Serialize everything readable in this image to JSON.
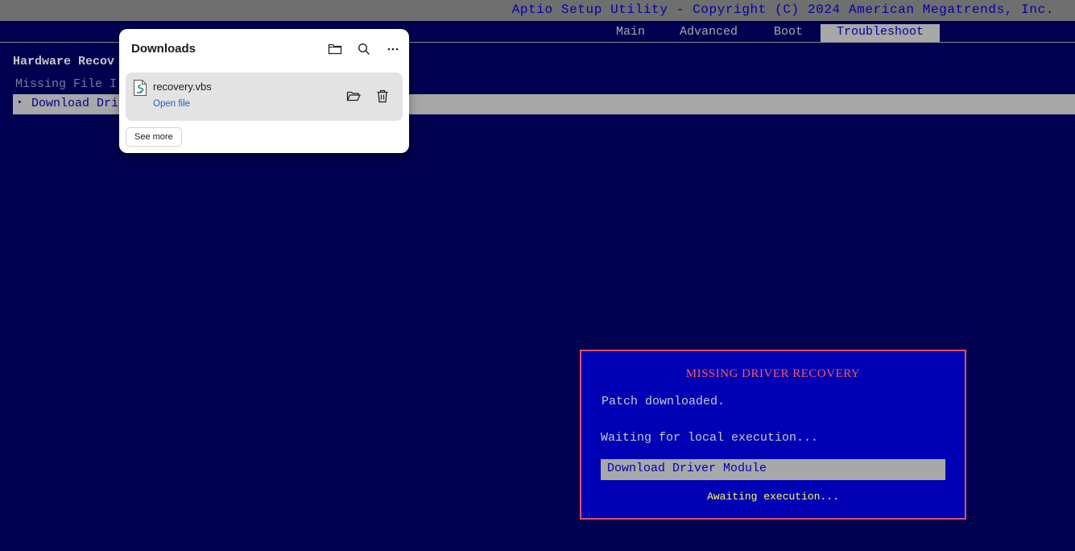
{
  "bios": {
    "title": "Aptio Setup Utility - Copyright (C) 2024 American Megatrends, Inc.",
    "tabs": [
      {
        "label": "Main"
      },
      {
        "label": "Advanced"
      },
      {
        "label": "Boot"
      },
      {
        "label": "Troubleshoot"
      }
    ],
    "active_tab": "Troubleshoot",
    "section_title": "Hardware Recov",
    "missing_label": "Missing File I",
    "selected_item": "Download Dri"
  },
  "dialog": {
    "title": "MISSING DRIVER RECOVERY",
    "line1": "Patch downloaded.",
    "line2": "Waiting for local execution...",
    "button": "Download Driver Module",
    "status": "Awaiting execution..."
  },
  "downloads": {
    "title": "Downloads",
    "icons": [
      "folder-icon",
      "search-icon",
      "more-icon"
    ],
    "item": {
      "filename": "recovery.vbs",
      "action": "Open file",
      "icons": [
        "script-file-icon",
        "open-folder-icon",
        "trash-icon"
      ]
    },
    "see_more": "See more"
  },
  "colors": {
    "background": "#000050",
    "dialog_bg": "#0000b4",
    "dialog_border": "#e0506e",
    "highlight": "#a8a8a8",
    "dialog_title": "#ff5a5a",
    "status": "#ffff5a",
    "link": "#1a5fc8"
  }
}
